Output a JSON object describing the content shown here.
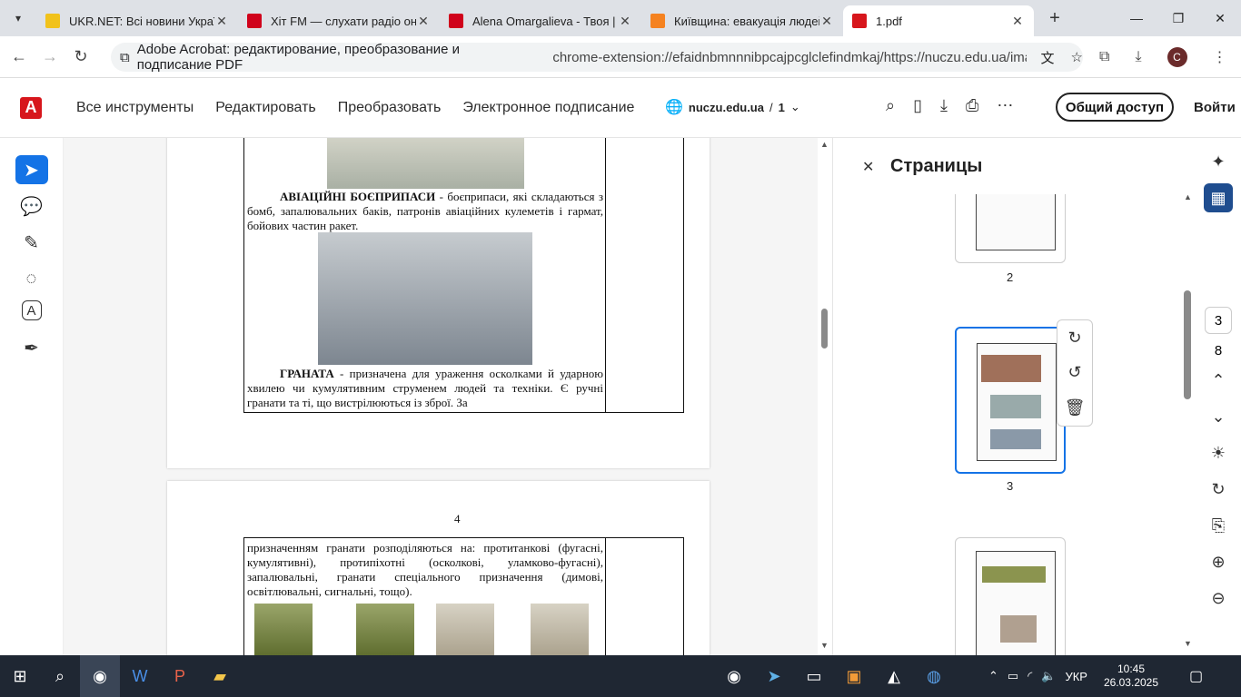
{
  "tabs": [
    {
      "title": "UKR.NET: Всі новини Україн",
      "color": "#f1c21b"
    },
    {
      "title": "Хіт FM — слухати радіо онл",
      "color": "#d0021b"
    },
    {
      "title": "Alena Omargalieva - Твоя |",
      "color": "#d0021b"
    },
    {
      "title": "Київщина: евакуація людей",
      "color": "#f58220"
    },
    {
      "title": "1.pdf",
      "color": "#d7161c"
    }
  ],
  "address": {
    "site": "Adobe Acrobat: редактирование, преобразование и подписание PDF",
    "url": "chrome-extension://efaidnbmnnnibpcajpcglclefindmkaj/https://nuczu.edu.ua/images/to..."
  },
  "acrobat": {
    "menu": [
      "Все инструменты",
      "Редактировать",
      "Преобразовать",
      "Электронное подписание"
    ],
    "doc_domain": "nuczu.edu.ua",
    "doc_sep": "/",
    "doc_page": "1",
    "share": "Общий доступ",
    "signin": "Войти"
  },
  "doc": {
    "p3_text1_bold": "АВІАЦІЙНІ БОЄПРИПАСИ",
    "p3_text1": " - боєприпаси, які складаються з бомб, запалювальних баків, патронів авіаційних кулеметів і гармат, бойових частин ракет.",
    "p3_text2_bold": "ГРАНАТА",
    "p3_text2": " - призначена для ураження осколками й ударною хвилею чи кумулятивним струменем людей та техніки. Є ручні гранати та ті, що вистрілюються із зброї. За",
    "p4_number": "4",
    "p4_text": "призначенням гранати розподіляються на: протитанкові (фугасні, кумулятивні), протипіхотні (осколкові, уламково-фугасні), запалювальні, гранати спеціального призначення (димові, освітлювальні, сигнальні, тощо)."
  },
  "pages_panel": {
    "title": "Страницы",
    "thumbs": [
      "2",
      "3"
    ]
  },
  "right_rail": {
    "page_current": "3",
    "page_total": "8"
  },
  "taskbar": {
    "lang": "УКР",
    "time": "10:45",
    "date": "26.03.2025"
  }
}
